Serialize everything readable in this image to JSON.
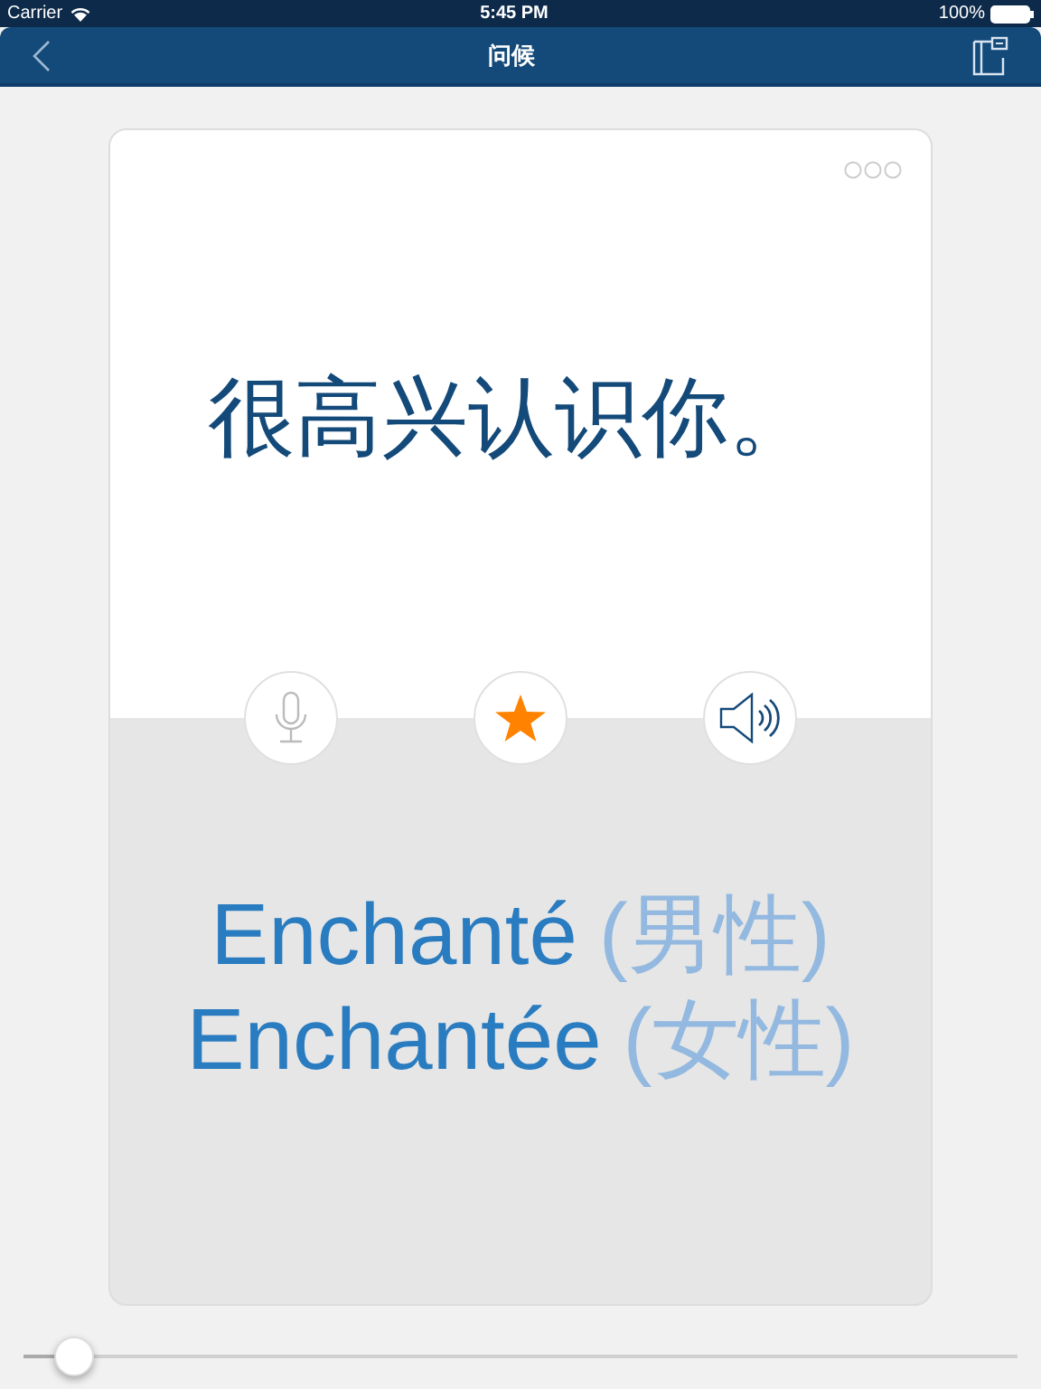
{
  "status_bar": {
    "carrier": "Carrier",
    "time": "5:45 PM",
    "battery": "100%"
  },
  "nav": {
    "title": "问候"
  },
  "card": {
    "phrase": "很高兴认识你。",
    "favorite": true,
    "translations": [
      {
        "text": "Enchanté",
        "note": "(男性)"
      },
      {
        "text": "Enchantée",
        "note": "(女性)"
      }
    ]
  },
  "slider": {
    "level": 0.05
  }
}
